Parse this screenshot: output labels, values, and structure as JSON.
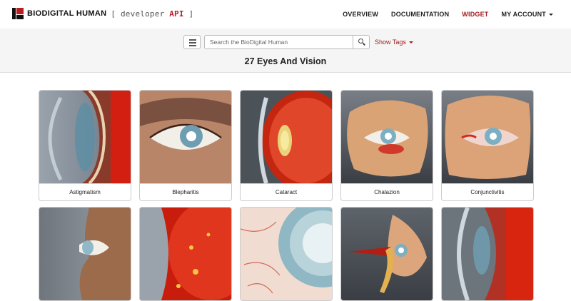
{
  "brand": {
    "name": "BIODIGITAL HUMAN",
    "sub_prefix": "[ developer ",
    "sub_api": "API",
    "sub_suffix": " ]"
  },
  "nav": {
    "items": [
      {
        "label": "OVERVIEW",
        "active": false
      },
      {
        "label": "DOCUMENTATION",
        "active": false
      },
      {
        "label": "WIDGET",
        "active": true
      },
      {
        "label": "MY ACCOUNT",
        "active": false,
        "dropdown": true
      }
    ],
    "accent": "#a01a1f"
  },
  "search": {
    "placeholder": "Search the BioDigital Human",
    "value": "",
    "show_tags_label": "Show Tags"
  },
  "page_title": "27 Eyes And Vision",
  "cards": [
    {
      "label": "Astigmatism",
      "icon": "astigmatism-eye-section"
    },
    {
      "label": "Blepharitis",
      "icon": "blepharitis-eye"
    },
    {
      "label": "Cataract",
      "icon": "cataract-eye-section"
    },
    {
      "label": "Chalazion",
      "icon": "chalazion-eye"
    },
    {
      "label": "Conjunctivitis",
      "icon": "conjunctivitis-eye"
    },
    {
      "label": "",
      "icon": "eye-side-profile"
    },
    {
      "label": "",
      "icon": "retina-spots"
    },
    {
      "label": "",
      "icon": "iris-closeup"
    },
    {
      "label": "",
      "icon": "eye-muscles"
    },
    {
      "label": "",
      "icon": "eye-section"
    }
  ]
}
